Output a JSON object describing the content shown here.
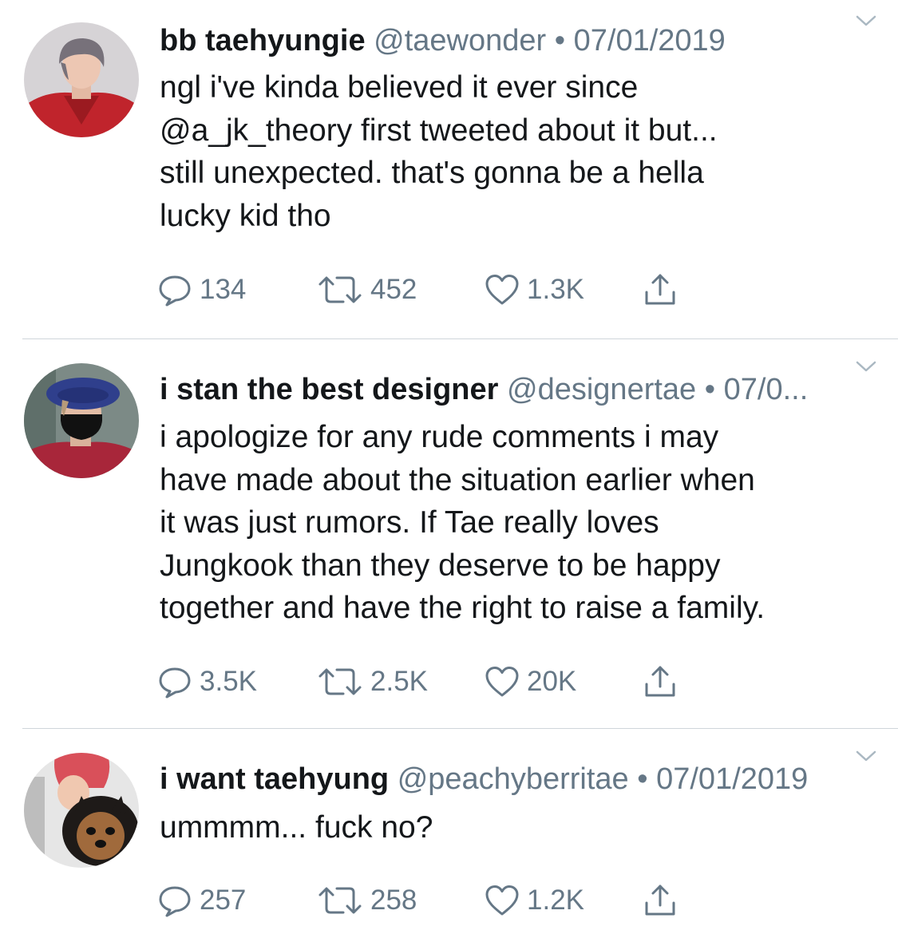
{
  "tweets": [
    {
      "display_name": "bb taehyungie",
      "handle": "@taewonder",
      "separator": "•",
      "date": "07/01/2019",
      "text_lines": [
        "ngl i've kinda believed it ever since",
        "@a_jk_theory first tweeted about it but...",
        "still unexpected. that's gonna be a hella",
        "lucky kid tho"
      ],
      "replies": "134",
      "retweets": "452",
      "likes": "1.3K",
      "avatar_icon": "avatar-red-shirt"
    },
    {
      "display_name": "i stan the best designer",
      "handle": "@designertae",
      "separator": "•",
      "date": "07/0...",
      "text_lines": [
        "i apologize for any rude comments i may",
        "have made about the situation earlier when",
        "it was just rumors. If Tae really loves",
        "Jungkook than they deserve to be happy",
        "together and have the right to raise a family."
      ],
      "replies": "3.5K",
      "retweets": "2.5K",
      "likes": "20K",
      "avatar_icon": "avatar-beret-mask"
    },
    {
      "display_name": "i want taehyung",
      "handle": "@peachyberritae",
      "separator": "•",
      "date": "07/01/2019",
      "text_lines": [
        "ummmm... fuck no?"
      ],
      "replies": "257",
      "retweets": "258",
      "likes": "1.2K",
      "avatar_icon": "avatar-red-hair-dog"
    }
  ],
  "icons": {
    "reply": "reply-icon",
    "retweet": "retweet-icon",
    "like": "heart-icon",
    "share": "share-icon",
    "menu": "chevron-down-icon"
  },
  "colors": {
    "text": "#14171a",
    "secondary": "#657786",
    "divider": "#cfd5da",
    "background": "#ffffff"
  }
}
